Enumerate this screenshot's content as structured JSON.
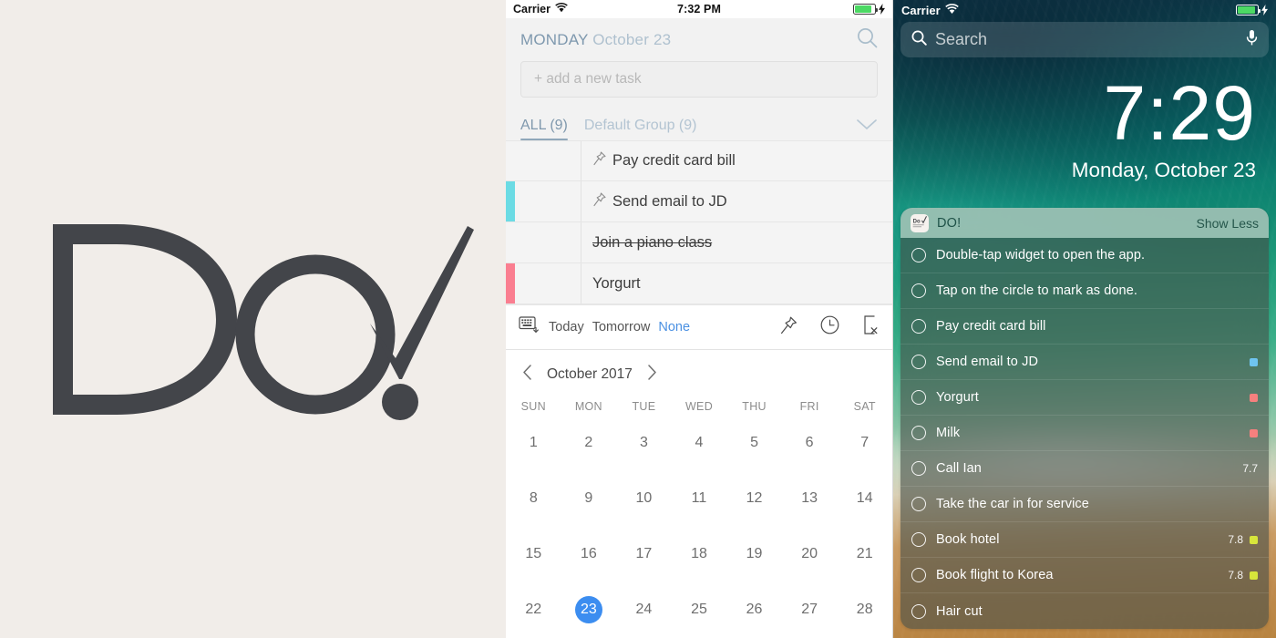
{
  "left_panel": {
    "logo_text": "Do",
    "logo_color": "#43454A",
    "background": "#F1EDE9"
  },
  "app": {
    "statusbar": {
      "carrier": "Carrier",
      "time": "7:32 PM",
      "wifi_icon": "wifi-icon",
      "battery_icon": "battery-icon",
      "charging_icon": "lightning-bolt-icon"
    },
    "header": {
      "day_of_week": "MONDAY",
      "date": "October 23",
      "search_icon": "search-icon"
    },
    "add_task_placeholder": "+ add a new task",
    "tabs": [
      {
        "label": "ALL (9)",
        "active": true
      },
      {
        "label": "Default Group (9)",
        "active": false
      }
    ],
    "tabs_chevron_icon": "chevron-down-icon",
    "tasks": [
      {
        "title": "Pay credit card bill",
        "pinned": true,
        "done": false,
        "color": ""
      },
      {
        "title": "Send email to JD",
        "pinned": true,
        "done": false,
        "color": "#6BDBE4"
      },
      {
        "title": "Join a piano class",
        "pinned": false,
        "done": true,
        "color": ""
      },
      {
        "title": "Yorgurt",
        "pinned": false,
        "done": false,
        "color": "#FA7E90"
      }
    ],
    "action_bar": {
      "keyboard_icon": "keyboard-dismiss-icon",
      "quick_dates": [
        {
          "label": "Today",
          "selected": false
        },
        {
          "label": "Tomorrow",
          "selected": false
        },
        {
          "label": "None",
          "selected": true
        }
      ],
      "icons": [
        "pin-icon",
        "clock-icon",
        "delete-note-icon"
      ]
    },
    "calendar": {
      "prev_icon": "chevron-left-icon",
      "next_icon": "chevron-right-icon",
      "title": "October 2017",
      "weekdays": [
        "SUN",
        "MON",
        "TUE",
        "WED",
        "THU",
        "FRI",
        "SAT"
      ],
      "weeks": [
        [
          "1",
          "2",
          "3",
          "4",
          "5",
          "6",
          "7"
        ],
        [
          "8",
          "9",
          "10",
          "11",
          "12",
          "13",
          "14"
        ],
        [
          "15",
          "16",
          "17",
          "18",
          "19",
          "20",
          "21"
        ],
        [
          "22",
          "23",
          "24",
          "25",
          "26",
          "27",
          "28"
        ]
      ],
      "today": "23",
      "today_color": "#3C8DF0"
    }
  },
  "lockscreen": {
    "statusbar": {
      "carrier": "Carrier",
      "wifi_icon": "wifi-icon",
      "battery_icon": "battery-icon",
      "charging_icon": "lightning-bolt-icon"
    },
    "search": {
      "placeholder": "Search",
      "search_icon": "search-icon",
      "mic_icon": "microphone-icon"
    },
    "clock": {
      "time": "7:29",
      "date": "Monday, October 23"
    },
    "widget": {
      "app_name": "DO!",
      "app_icon": "do-app-icon",
      "show_less_label": "Show Less",
      "items": [
        {
          "title": "Double-tap widget to open the app.",
          "num": "",
          "color": ""
        },
        {
          "title": "Tap on the circle to mark as done.",
          "num": "",
          "color": ""
        },
        {
          "title": "Pay credit card bill",
          "num": "",
          "color": ""
        },
        {
          "title": "Send email to JD",
          "num": "",
          "color": "#6FC4F0"
        },
        {
          "title": "Yorgurt",
          "num": "",
          "color": "#F5807E"
        },
        {
          "title": "Milk",
          "num": "",
          "color": "#F5807E"
        },
        {
          "title": "Call Ian",
          "num": "7.7",
          "color": ""
        },
        {
          "title": "Take the car in for service",
          "num": "",
          "color": ""
        },
        {
          "title": "Book hotel",
          "num": "7.8",
          "color": "#D7E53B"
        },
        {
          "title": "Book flight to Korea",
          "num": "7.8",
          "color": "#D7E53B"
        },
        {
          "title": "Hair cut",
          "num": "",
          "color": ""
        }
      ]
    }
  }
}
